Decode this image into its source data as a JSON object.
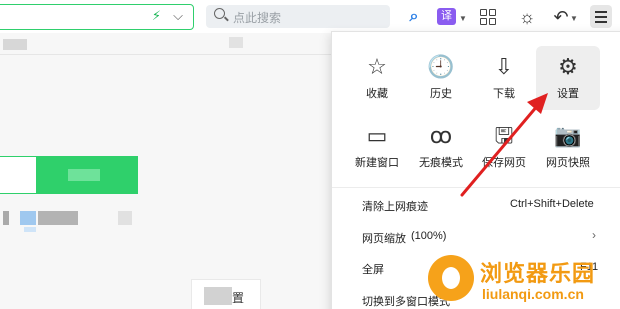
{
  "toolbar": {
    "search_placeholder": "点此搜索",
    "translate_label": "译",
    "icons": [
      "lightning-icon",
      "chevron-down-icon",
      "search-icon",
      "find-icon",
      "translate-icon",
      "apps-grid-icon",
      "theme-icon",
      "undo-icon",
      "menu-icon"
    ]
  },
  "menu": {
    "tiles": [
      {
        "label": "收藏",
        "icon": "star-icon",
        "glyph": "☆"
      },
      {
        "label": "历史",
        "icon": "clock-icon",
        "glyph": "🕘"
      },
      {
        "label": "下载",
        "icon": "download-icon",
        "glyph": "⇩"
      },
      {
        "label": "设置",
        "icon": "gear-icon",
        "glyph": "⚙"
      },
      {
        "label": "新建窗口",
        "icon": "window-icon",
        "glyph": "▭"
      },
      {
        "label": "无痕模式",
        "icon": "incognito-icon",
        "glyph": "ꝏ"
      },
      {
        "label": "保存网页",
        "icon": "save-icon",
        "glyph": "🖫"
      },
      {
        "label": "网页快照",
        "icon": "camera-icon",
        "glyph": "📷"
      }
    ],
    "rows": [
      {
        "label": "清除上网痕迹",
        "shortcut": "Ctrl+Shift+Delete"
      },
      {
        "label": "网页缩放",
        "shortcut": "(100%)"
      },
      {
        "label": "全屏",
        "shortcut": "F11"
      },
      {
        "label": "切换到多窗口模式",
        "shortcut": ""
      }
    ]
  },
  "background": {
    "card_text": "置"
  },
  "watermark": {
    "title": "浏览器乐园",
    "url": "liulanqi.com.cn"
  },
  "colors": {
    "accent_green": "#2fd06b",
    "arrow_red": "#e02020",
    "watermark_orange": "#f29a12",
    "translate_purple": "#8a5cf0"
  }
}
